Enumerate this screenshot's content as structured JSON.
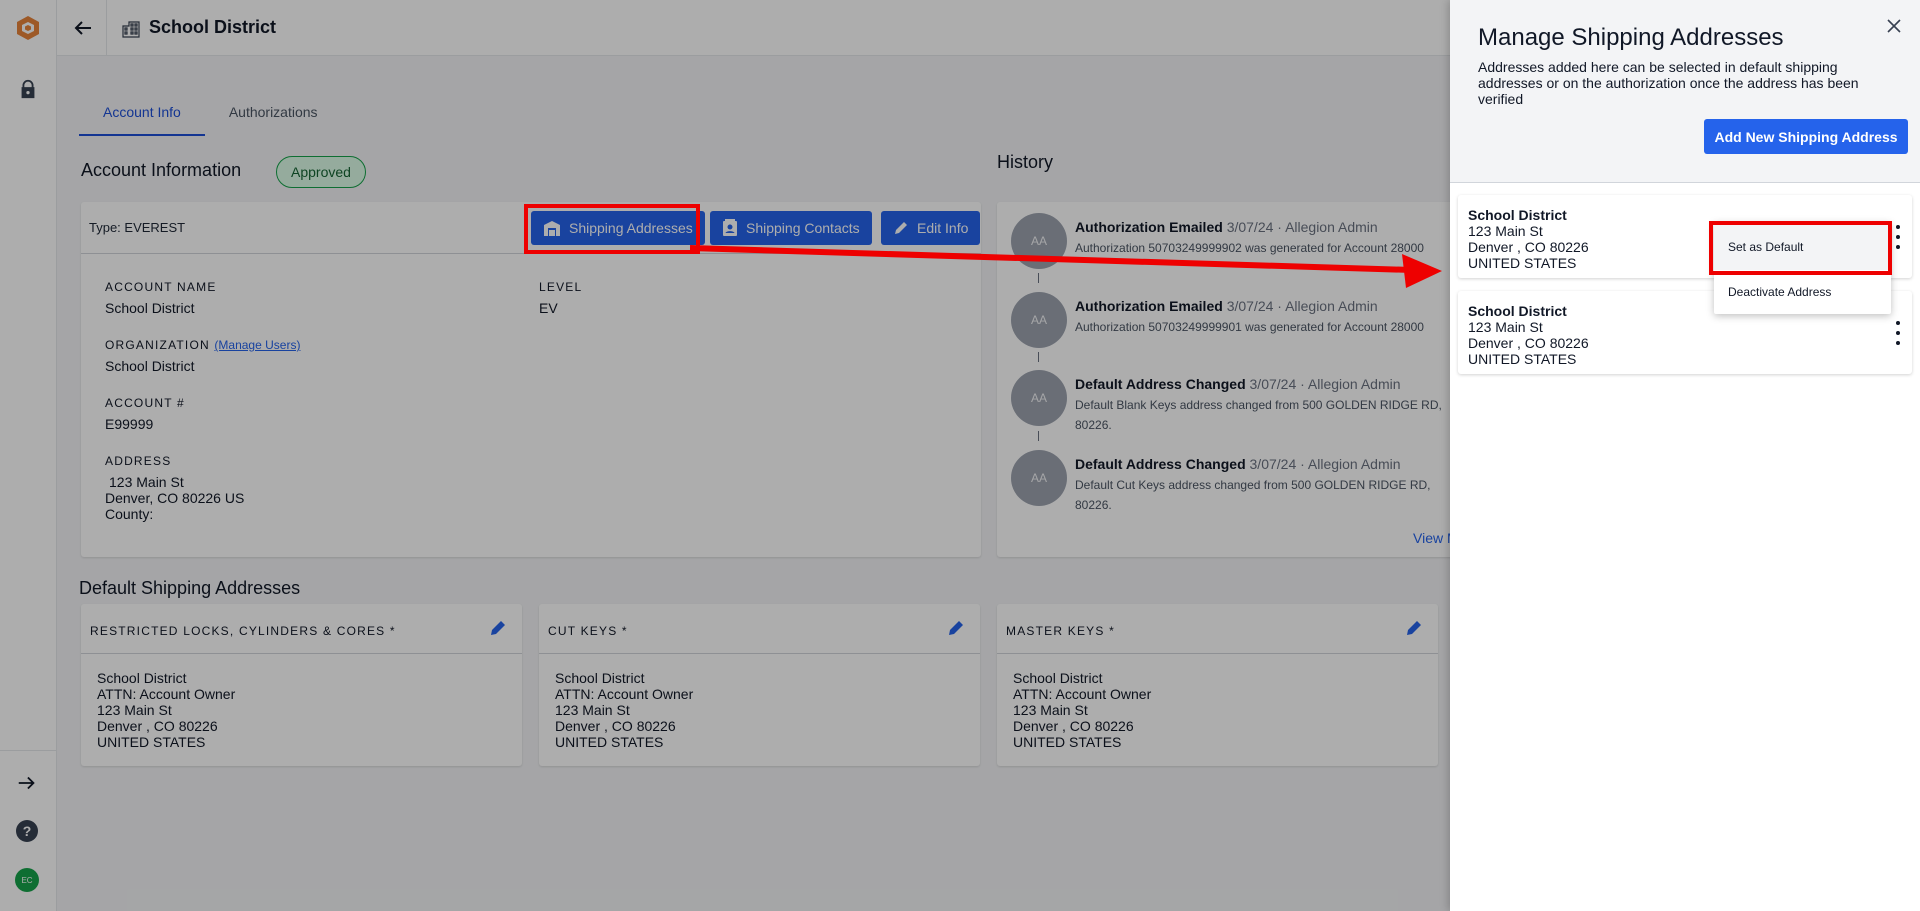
{
  "topbar": {
    "title": "School District"
  },
  "tabs": [
    {
      "label": "Account Info"
    },
    {
      "label": "Authorizations"
    }
  ],
  "account": {
    "section_title": "Account Information",
    "status": "Approved",
    "type": "Type: EVEREST",
    "buttons": {
      "shipping_addresses": "Shipping Addresses",
      "shipping_contacts": "Shipping Contacts",
      "edit_info": "Edit Info"
    },
    "fields": {
      "account_name_label": "ACCOUNT NAME",
      "account_name": "School District",
      "level_label": "LEVEL",
      "level": "EV",
      "organization_label": "ORGANIZATION",
      "manage_users": "(Manage Users)",
      "organization": "School District",
      "account_no_label": "ACCOUNT #",
      "account_no": "E99999",
      "address_label": "ADDRESS",
      "address_line1": "123 Main St",
      "address_line2": "Denver, CO 80226 US",
      "address_line3": "County:"
    }
  },
  "history": {
    "title": "History",
    "view_more": "View M",
    "items": [
      {
        "avatar": "AA",
        "event": "Authorization Emailed",
        "meta": "3/07/24 · Allegion Admin",
        "desc": "Authorization 50703249999902 was generated for Account 28000"
      },
      {
        "avatar": "AA",
        "event": "Authorization Emailed",
        "meta": "3/07/24 · Allegion Admin",
        "desc": "Authorization 50703249999901 was generated for Account 28000"
      },
      {
        "avatar": "AA",
        "event": "Default Address Changed",
        "meta": "3/07/24 · Allegion Admin",
        "desc": "Default Blank Keys address changed from 500 GOLDEN RIDGE RD, 80226."
      },
      {
        "avatar": "AA",
        "event": "Default Address Changed",
        "meta": "3/07/24 · Allegion Admin",
        "desc": "Default Cut Keys address changed from 500 GOLDEN RIDGE RD, 80226."
      }
    ]
  },
  "default_shipping": {
    "title": "Default Shipping Addresses",
    "cards": [
      {
        "label": "RESTRICTED LOCKS, CYLINDERS & CORES *",
        "lines": [
          "School District",
          "ATTN: Account Owner",
          "123 Main St",
          "Denver , CO 80226",
          "UNITED STATES"
        ]
      },
      {
        "label": "CUT KEYS *",
        "lines": [
          "School District",
          "ATTN: Account Owner",
          "123 Main St",
          "Denver , CO 80226",
          "UNITED STATES"
        ]
      },
      {
        "label": "MASTER KEYS *",
        "lines": [
          "School District",
          "ATTN: Account Owner",
          "123 Main St",
          "Denver , CO 80226",
          "UNITED STATES"
        ]
      }
    ]
  },
  "drawer": {
    "title": "Manage Shipping Addresses",
    "description": "Addresses added here can be selected in default shipping addresses or on the authorization once the address has been verified",
    "add_button": "Add New Shipping Address",
    "addresses": [
      {
        "name": "School District",
        "line1": "123 Main St",
        "line2": "Denver , CO 80226",
        "country": "UNITED STATES"
      },
      {
        "name": "School District",
        "line1": "123 Main St",
        "line2": "Denver , CO 80226",
        "country": "UNITED STATES"
      }
    ],
    "menu": {
      "set_default": "Set as Default",
      "deactivate": "Deactivate Address"
    }
  },
  "colors": {
    "primary": "#2563eb",
    "highlight": "#ee0000",
    "approved_bg": "#dcfce7"
  }
}
